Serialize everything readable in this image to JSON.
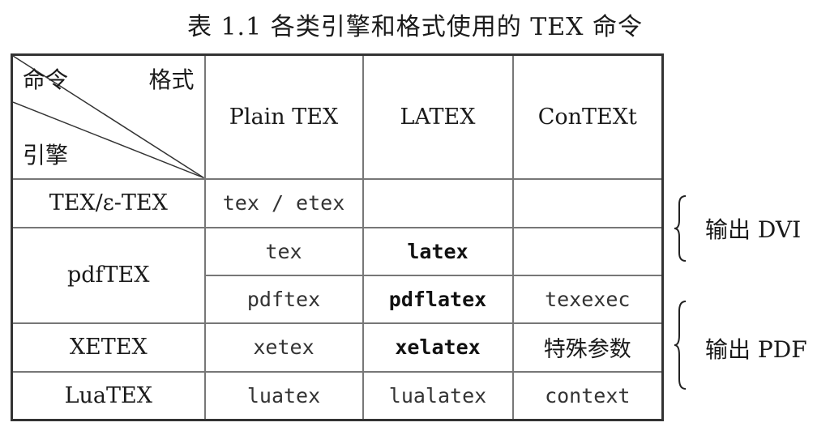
{
  "caption": "表 1.1   各类引擎和格式使用的 TEX 命令",
  "corner": {
    "command": "命令",
    "format": "格式",
    "engine": "引擎"
  },
  "formats": [
    "Plain TEX",
    "LATEX",
    "ConTEXt"
  ],
  "rows": [
    {
      "engine": "TEX/ε-TEX",
      "plain": "tex / etex",
      "latex": "",
      "context": ""
    },
    {
      "engine": "pdfTEX",
      "plain": "tex",
      "latex": "latex",
      "context": ""
    },
    {
      "engine": "",
      "plain": "pdftex",
      "latex": "pdflatex",
      "context": "texexec"
    },
    {
      "engine": "XETEX",
      "plain": "xetex",
      "latex": "xelatex",
      "context": "特殊参数"
    },
    {
      "engine": "LuaTEX",
      "plain": "luatex",
      "latex": "lualatex",
      "context": "context"
    }
  ],
  "annotations": {
    "dvi": "输出 DVI",
    "pdf": "输出 PDF"
  }
}
